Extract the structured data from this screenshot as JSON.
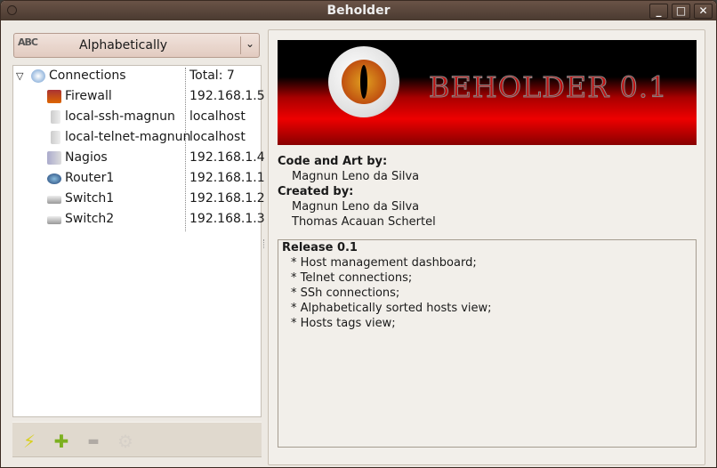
{
  "window": {
    "title": "Beholder",
    "minimize": "_",
    "maximize": "□",
    "close": "✕"
  },
  "sort_combo": {
    "value": "Alphabetically",
    "icon_text": "ABC"
  },
  "tree": {
    "root": {
      "name": "Connections",
      "value": "Total: 7"
    },
    "items": [
      {
        "name": "Firewall",
        "value": "192.168.1.5",
        "icon": "firewall-icon"
      },
      {
        "name": "local-ssh-magnun",
        "value": "localhost",
        "icon": "server-icon"
      },
      {
        "name": "local-telnet-magnun",
        "value": "localhost",
        "icon": "server-icon"
      },
      {
        "name": "Nagios",
        "value": "192.168.1.4",
        "icon": "monitor-server-icon"
      },
      {
        "name": "Router1",
        "value": "192.168.1.1",
        "icon": "router-icon"
      },
      {
        "name": "Switch1",
        "value": "192.168.1.2",
        "icon": "switch-icon"
      },
      {
        "name": "Switch2",
        "value": "192.168.1.3",
        "icon": "switch-icon"
      }
    ]
  },
  "toolbar": {
    "connect": "⚡",
    "add": "✚",
    "remove": "▬",
    "settings": "⚙"
  },
  "about": {
    "banner_text": "BEHOLDER 0.1",
    "code_label": "Code and Art by:",
    "code_author": "Magnun Leno da Silva",
    "created_label": "Created by:",
    "creators": [
      "Magnun Leno da Silva",
      "Thomas Acauan Schertel"
    ]
  },
  "release_notes": {
    "title": "Release 0.1",
    "items": [
      "* Host management dashboard;",
      "* Telnet connections;",
      "* SSh connections;",
      "* Alphabetically sorted hosts view;",
      "* Hosts tags view;"
    ]
  }
}
